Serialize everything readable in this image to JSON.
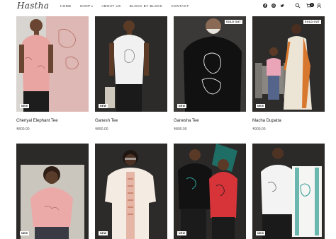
{
  "brand": {
    "logo_text": "Hastha"
  },
  "nav": [
    {
      "label": "Home"
    },
    {
      "label": "Shop"
    },
    {
      "label": "About Us"
    },
    {
      "label": "Block by Block"
    },
    {
      "label": "Contact"
    }
  ],
  "nav_shop_chevron": "▾",
  "social_icons": [
    "facebook-icon",
    "instagram-icon",
    "twitter-icon"
  ],
  "tools": {
    "search_icon": "search-icon",
    "account_icon": "user-icon",
    "cart_icon": "cart-icon",
    "cart_count": "0"
  },
  "products": [
    {
      "title": "Cheriyal Elephant Tee",
      "price": "₹800.00",
      "badge": "NEW",
      "sold_out": "",
      "shirt_color": "#e8a7a3",
      "bg_color": "#d6d3cf"
    },
    {
      "title": "Ganesh Tee",
      "price": "₹850.00",
      "badge": "NEW",
      "sold_out": "",
      "shirt_color": "#f2f2f2",
      "bg_color": "#2a2928"
    },
    {
      "title": "Ganesha Tee",
      "price": "₹800.00",
      "badge": "NEW",
      "sold_out": "SOLD OUT",
      "shirt_color": "#111111",
      "bg_color": "#2d2c2b"
    },
    {
      "title": "Macha Dupatta",
      "price": "₹900.00",
      "badge": "NEW",
      "sold_out": "SOLD OUT",
      "shirt_color": "#e8a7b8",
      "bg_color": "#2a2928"
    },
    {
      "title": "",
      "price": "",
      "badge": "NEW",
      "sold_out": "",
      "shirt_color": "#eba9a8",
      "bg_color": "#2a2928"
    },
    {
      "title": "",
      "price": "",
      "badge": "NEW",
      "sold_out": "",
      "shirt_color": "#f5ece4",
      "bg_color": "#2a2928"
    },
    {
      "title": "",
      "price": "",
      "badge": "NEW",
      "sold_out": "",
      "shirt_color": "#111111",
      "bg_color": "#2a2928"
    },
    {
      "title": "",
      "price": "",
      "badge": "NEW",
      "sold_out": "",
      "shirt_color": "#f3f3f3",
      "bg_color": "#2a2928"
    }
  ]
}
